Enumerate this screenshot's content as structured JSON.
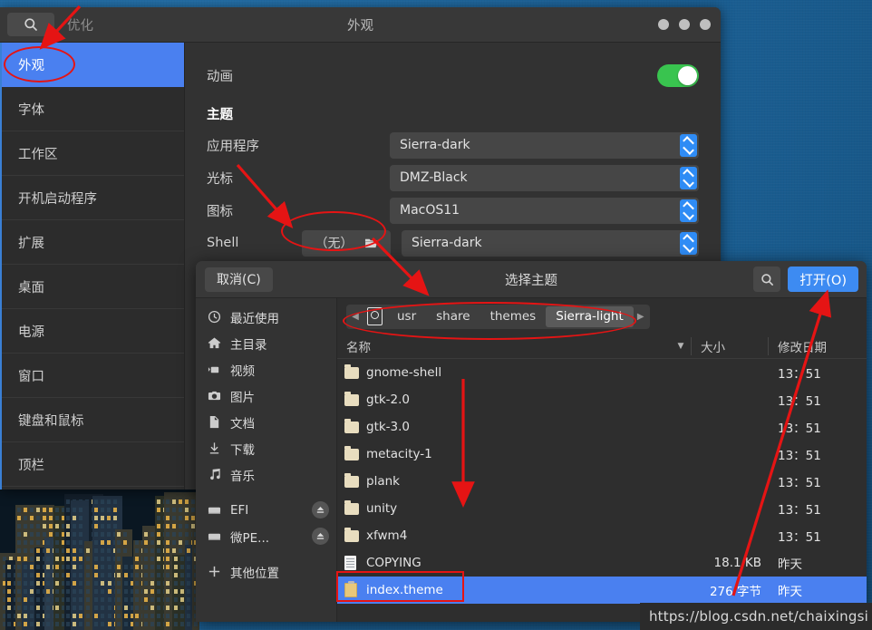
{
  "desktop": {
    "wallpaper_name": "city-skyline-night",
    "background_color": "#1d6399"
  },
  "tweaks_window": {
    "app_title": "优化",
    "window_title": "外观",
    "search_icon": "search-icon",
    "window_buttons": [
      "minimize",
      "maximize",
      "close"
    ],
    "sidebar": {
      "items": [
        {
          "label": "外观",
          "selected": true
        },
        {
          "label": "字体",
          "selected": false
        },
        {
          "label": "工作区",
          "selected": false
        },
        {
          "label": "开机启动程序",
          "selected": false
        },
        {
          "label": "扩展",
          "selected": false
        },
        {
          "label": "桌面",
          "selected": false
        },
        {
          "label": "电源",
          "selected": false
        },
        {
          "label": "窗口",
          "selected": false
        },
        {
          "label": "键盘和鼠标",
          "selected": false
        },
        {
          "label": "顶栏",
          "selected": false
        }
      ]
    },
    "content": {
      "animation_label": "动画",
      "animation_toggle_on": true,
      "toggle_color": "#39c44f",
      "theme_section": "主题",
      "rows": [
        {
          "label": "应用程序",
          "value": "Sierra-dark"
        },
        {
          "label": "光标",
          "value": "DMZ-Black"
        },
        {
          "label": "图标",
          "value": "MacOS11"
        },
        {
          "label": "Shell",
          "value": "Sierra-dark",
          "none_button": "（无）",
          "file_icon": "open-file-icon"
        }
      ],
      "spinner_color": "#2f8cf5"
    }
  },
  "file_chooser": {
    "cancel_label": "取消(C)",
    "cancel_mnemonic": "C",
    "title": "选择主题",
    "search_icon": "search-icon",
    "open_label": "打开(O)",
    "open_mnemonic": "O",
    "open_button_color": "#3d8bf2",
    "places": [
      {
        "label": "最近使用",
        "icon": "clock-icon"
      },
      {
        "label": "主目录",
        "icon": "home-icon"
      },
      {
        "label": "视频",
        "icon": "video-icon"
      },
      {
        "label": "图片",
        "icon": "camera-icon"
      },
      {
        "label": "文档",
        "icon": "document-icon"
      },
      {
        "label": "下载",
        "icon": "download-icon"
      },
      {
        "label": "音乐",
        "icon": "music-icon"
      },
      {
        "label": "EFI",
        "icon": "drive-icon",
        "eject": true
      },
      {
        "label": "微PE...",
        "icon": "drive-icon",
        "eject": true
      },
      {
        "label": "其他位置",
        "icon": "plus-icon"
      }
    ],
    "breadcrumbs": {
      "prev_icon": "chevron-left-icon",
      "next_icon": "chevron-right-icon",
      "root_icon": "filesystem-icon",
      "items": [
        {
          "label": "usr",
          "active": false
        },
        {
          "label": "share",
          "active": false
        },
        {
          "label": "themes",
          "active": false
        },
        {
          "label": "Sierra-light",
          "active": true
        }
      ]
    },
    "columns": {
      "name": "名称",
      "sort_icon": "sort-descending-icon",
      "size": "大小",
      "modified": "修改日期"
    },
    "files": [
      {
        "name": "gnome-shell",
        "type": "folder",
        "size": "",
        "modified": "13：51",
        "selected": false
      },
      {
        "name": "gtk-2.0",
        "type": "folder",
        "size": "",
        "modified": "13：51",
        "selected": false
      },
      {
        "name": "gtk-3.0",
        "type": "folder",
        "size": "",
        "modified": "13：51",
        "selected": false
      },
      {
        "name": "metacity-1",
        "type": "folder",
        "size": "",
        "modified": "13：51",
        "selected": false
      },
      {
        "name": "plank",
        "type": "folder",
        "size": "",
        "modified": "13：51",
        "selected": false
      },
      {
        "name": "unity",
        "type": "folder",
        "size": "",
        "modified": "13：51",
        "selected": false
      },
      {
        "name": "xfwm4",
        "type": "folder",
        "size": "",
        "modified": "13：51",
        "selected": false
      },
      {
        "name": "COPYING",
        "type": "document",
        "size": "18.1 KB",
        "modified": "昨天",
        "selected": false
      },
      {
        "name": "index.theme",
        "type": "theme",
        "size": "276 字节",
        "modified": "昨天",
        "selected": true
      }
    ],
    "selection_color": "#4a80f0"
  },
  "watermark": {
    "text": "https://blog.csdn.net/chaixingsi"
  },
  "annotations": {
    "color": "#e51414",
    "shapes": [
      "arrow-to-sidebar-appearance",
      "ellipse-around-appearance-item",
      "arrow-to-shell-none-button",
      "ellipse-around-shell-none-button",
      "arrow-to-dialog-title",
      "ellipse-around-breadcrumbs",
      "arrow-down-filelist",
      "arrow-to-open-button",
      "rect-around-index-theme"
    ]
  }
}
